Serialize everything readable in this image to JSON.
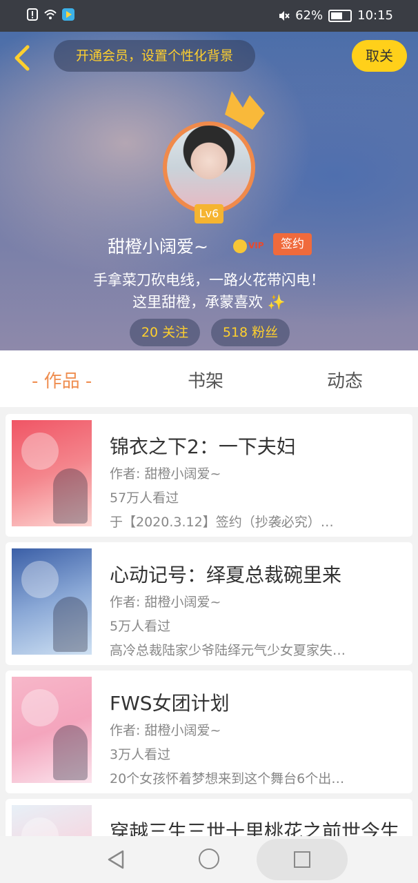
{
  "status_bar": {
    "battery": "62%",
    "time": "10:15"
  },
  "header": {
    "vip_banner": "开通会员，设置个性化背景",
    "cancel": "取关",
    "level": "Lv6",
    "username": "甜橙小阔爱~",
    "vip_text": "VIP",
    "sign_badge": "签约",
    "bio_line1": "手拿菜刀砍电线，一路火花带闪电！",
    "bio_line2": "这里甜橙，承蒙喜欢 ✨",
    "following": "20 关注",
    "fans": "518 粉丝"
  },
  "tabs": [
    {
      "label": "- 作品 -",
      "active": true
    },
    {
      "label": "书架",
      "active": false
    },
    {
      "label": "动态",
      "active": false
    }
  ],
  "books": [
    {
      "title": "锦衣之下2：一下夫妇",
      "author": "作者: 甜橙小阔爱~",
      "views": "57万人看过",
      "desc": "于【2020.3.12】签约（抄袭必究）…"
    },
    {
      "title": "心动记号：绎夏总裁碗里来",
      "author": "作者: 甜橙小阔爱~",
      "views": "5万人看过",
      "desc": "高冷总裁陆家少爷陆绎元气少女夏家失…"
    },
    {
      "title": "FWS女团计划",
      "author": "作者: 甜橙小阔爱~",
      "views": "3万人看过",
      "desc": "20个女孩怀着梦想来到这个舞台6个出…"
    },
    {
      "title": "穿越三生三世十里桃花之前世今生",
      "author": "",
      "views": "",
      "desc": ""
    }
  ],
  "colors": {
    "accent": "#ef8d4f",
    "yellow": "#ffd02e",
    "sign": "#f06a3c"
  }
}
